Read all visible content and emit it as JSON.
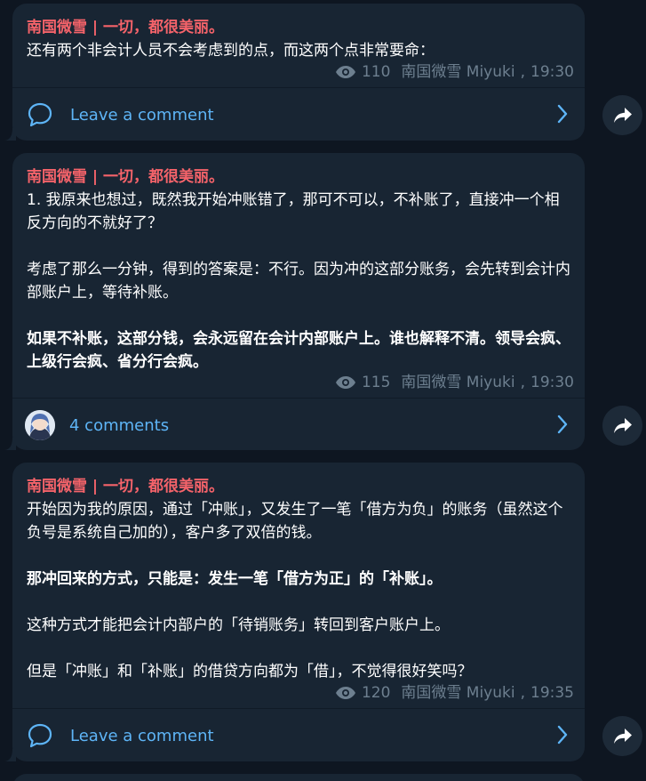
{
  "posts": [
    {
      "author": "南国微雪 | 一切，都很美丽。",
      "paragraphs": [
        "还有两个非会计人员不会考虑到的点，而这两个点非常要命："
      ],
      "views": "110",
      "meta_author": "南国微雪 Miyuki",
      "time": "19:30",
      "comment_label": "Leave a comment"
    },
    {
      "author": "南国微雪 | 一切，都很美丽。",
      "paragraphs": [
        "1. 我原来也想过，既然我开始冲账错了，那可不可以，不补账了，直接冲一个相反方向的不就好了？",
        "考虑了那么一分钟，得到的答案是：不行。因为冲的这部分账务，会先转到会计内部账户上，等待补账。",
        "如果不补账，这部分钱，会永远留在会计内部账户上。谁也解释不清。领导会疯、上级行会疯、省分行会疯。"
      ],
      "views": "115",
      "meta_author": "南国微雪 Miyuki",
      "time": "19:30",
      "comment_label": "4 comments"
    },
    {
      "author": "南国微雪 | 一切，都很美丽。",
      "paragraphs": [
        "开始因为我的原因，通过「冲账」，又发生了一笔「借方为负」的账务（虽然这个负号是系统自己加的），客户多了双倍的钱。",
        "那冲回来的方式，只能是：发生一笔「借方为正」的「补账」。",
        "这种方式才能把会计内部户的「待销账务」转回到客户账户上。",
        "但是「冲账」和「补账」的借贷方向都为「借」，不觉得很好笑吗？"
      ],
      "views": "120",
      "meta_author": "南国微雪 Miyuki",
      "time": "19:35",
      "comment_label": "Leave a comment"
    }
  ],
  "colors": {
    "background": "#0e1621",
    "bubble": "#182533",
    "author": "#f5636a",
    "link": "#5eb5f7",
    "meta": "#6d7f8f"
  },
  "icons": {
    "views": "eye-icon",
    "comment": "comment-bubble-icon",
    "chevron": "chevron-right-icon",
    "share": "share-arrow-icon"
  }
}
